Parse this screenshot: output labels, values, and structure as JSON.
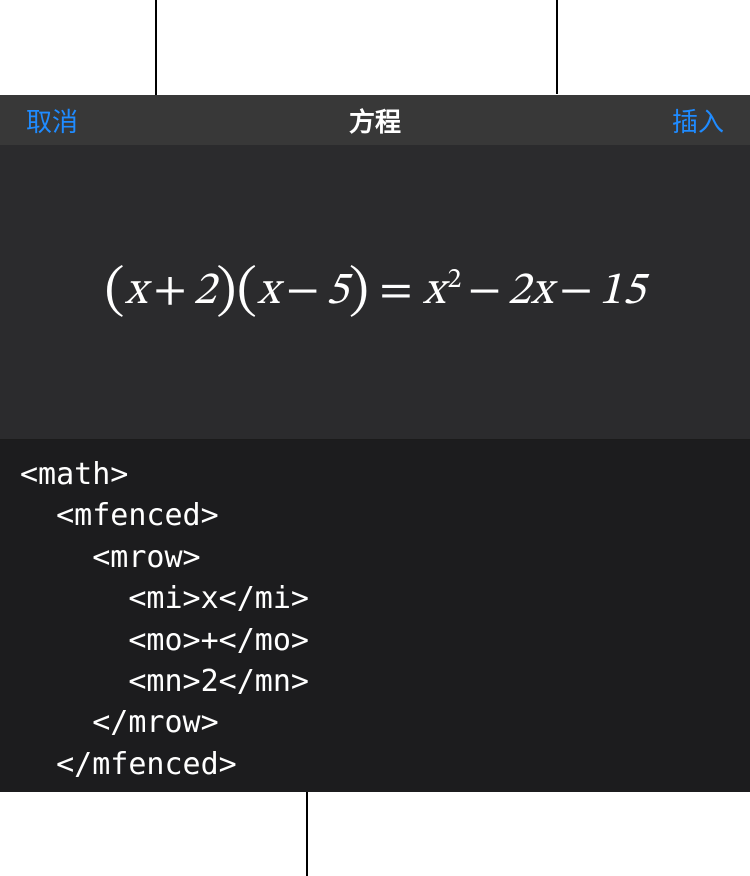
{
  "nav": {
    "cancel": "取消",
    "title": "方程",
    "insert": "插入"
  },
  "preview": {
    "equation_plain": "(x + 2)(x − 5) = x² − 2x − 15"
  },
  "code": {
    "text": "<math>\n  <mfenced>\n    <mrow>\n      <mi>x</mi>\n      <mo>+</mo>\n      <mn>2</mn>\n    </mrow>\n  </mfenced>\n  <mfenced>\n    <mrow>"
  }
}
